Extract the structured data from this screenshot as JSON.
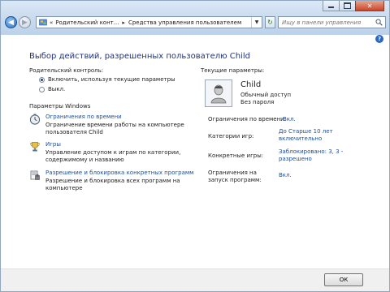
{
  "address": {
    "prefix": "«",
    "crumb1": "Родительский конт...",
    "separator": "▸",
    "crumb2": "Средства управления пользователем"
  },
  "search": {
    "placeholder": "Ищу в панели управления"
  },
  "page": {
    "title": "Выбор действий, разрешенных пользователю Child"
  },
  "parental_control": {
    "label": "Родительский контроль:",
    "options": [
      "Включить, используя текущие параметры",
      "Выкл."
    ],
    "selected": 0
  },
  "windows_settings": {
    "label": "Параметры Windows",
    "items": [
      {
        "link": "Ограничения по времени",
        "desc": [
          "Ограничение времени работы на компьютере",
          "пользователя Child"
        ],
        "icon": "clock-icon"
      },
      {
        "link": "Игры",
        "desc": [
          "Управление доступом к играм по категории,",
          "содержимому и названию"
        ],
        "icon": "trophy-icon"
      },
      {
        "link": "Разрешение и блокировка конкретных программ",
        "desc": [
          "Разрешение и блокировка всех программ на",
          "компьютере"
        ],
        "icon": "programs-icon"
      }
    ]
  },
  "current": {
    "label": "Текущие параметры:",
    "user_name": "Child",
    "account_type": "Обычный доступ",
    "password": "Без пароля",
    "rows": [
      {
        "key": [
          "Ограничения по времени:"
        ],
        "value": [
          "Вкл."
        ]
      },
      {
        "key": [
          "Категории игр:"
        ],
        "value": [
          "До Старше 10 лет",
          "включительно"
        ]
      },
      {
        "key": [
          "Конкретные игры:"
        ],
        "value": [
          "Заблокировано: 3, 3 -",
          "разрешено"
        ]
      },
      {
        "key": [
          "Ограничения на",
          "запуск программ:"
        ],
        "value": [
          "Вкл."
        ]
      }
    ]
  },
  "footer": {
    "ok_label": "ОК"
  },
  "colors": {
    "link": "#1e4fa0",
    "title": "#1e3287",
    "chrome": "#c8daee"
  }
}
